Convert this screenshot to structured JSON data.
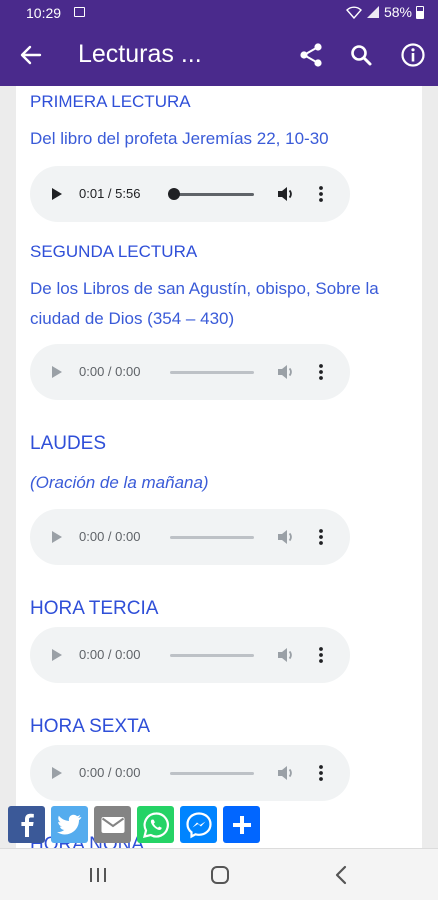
{
  "status": {
    "time": "10:29",
    "battery": "58%"
  },
  "appbar": {
    "title": "Lecturas ...",
    "back_icon": "arrow-back-icon",
    "actions": [
      "share-icon",
      "search-icon",
      "info-icon"
    ]
  },
  "sections": [
    {
      "title": "PRIMERA LECTURA",
      "subtitle": "Del libro del profeta Jeremías    22, 10-30",
      "player": {
        "time": "0:01 / 5:56",
        "progress": 0.0
      }
    },
    {
      "title": "SEGUNDA LECTURA",
      "subtitle": "De los Libros de san Agustín, obispo, Sobre la ciudad de Dios  (354 – 430)",
      "player": {
        "time": "0:00 / 0:00"
      }
    },
    {
      "title": "LAUDES",
      "subtitle": "(Oración de la mañana)",
      "player": {
        "time": "0:00 / 0:00"
      }
    },
    {
      "title": "HORA TERCIA",
      "player": {
        "time": "0:00 / 0:00"
      }
    },
    {
      "title": "HORA SEXTA",
      "player": {
        "time": "0:00 / 0:00"
      }
    },
    {
      "title": "HORA NONA"
    }
  ],
  "share_buttons": [
    "facebook-icon",
    "twitter-icon",
    "email-icon",
    "whatsapp-icon",
    "messenger-icon",
    "add-share-icon"
  ],
  "colors": {
    "primary": "#4a2a8c",
    "link": "#2f4fd8",
    "facebook": "#3b5998",
    "twitter": "#55acee",
    "whatsapp": "#25d366",
    "messenger": "#0084ff"
  }
}
